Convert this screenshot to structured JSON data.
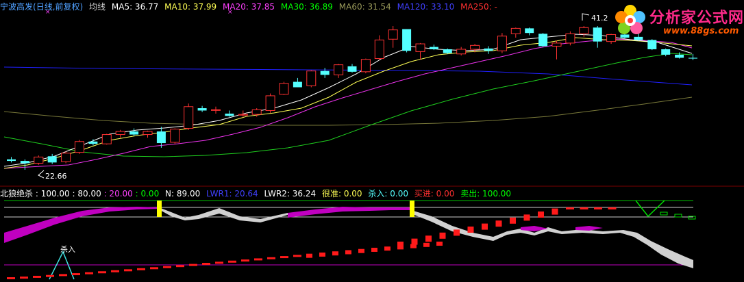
{
  "main_legend": {
    "stock": "宁波高发",
    "mode": "(日线,前复权)",
    "indicator": "均线",
    "ma5": "MA5: 36.77",
    "ma10": "MA10: 37.99",
    "ma20": "MA20: 37.85",
    "ma30": "MA30: 36.89",
    "ma60": "MA60: 31.54",
    "ma120": "MA120: 33.10",
    "ma250": "MA250: -"
  },
  "ind_legend": {
    "name": "北狼绝杀",
    "v1": ": 100.00",
    "v2": ": 80.00",
    "v3": ": 20.00",
    "v4": ": 0.00",
    "n": "N: 89.00",
    "lwr1": "LWR1: 20.64",
    "lwr2": "LWR2: 36.24",
    "hen": "很准: 0.00",
    "sharu": "杀入: 0.00",
    "maijin": "买进: 0.00",
    "maichu": "卖出: 100.00"
  },
  "annotations": {
    "high": "41.2",
    "low": "22.66",
    "kill_label": "杀入"
  },
  "logo": {
    "text": "分析家公式网",
    "url": "www.88gs.com"
  },
  "colors": {
    "up": "#ff3232",
    "down": "#54ffff",
    "ma5": "#ffffff",
    "ma10": "#ffff55",
    "ma20": "#ff40ff",
    "ma30": "#00ff00",
    "ma60": "#808040",
    "ma120": "#0000ff",
    "ma250": "#ff0000"
  },
  "chart_data": {
    "type": "candlestick",
    "ohlc": [
      [
        24.0,
        24.3,
        23.6,
        23.8
      ],
      [
        23.8,
        24.0,
        22.66,
        23.5
      ],
      [
        23.5,
        24.5,
        23.3,
        24.3
      ],
      [
        24.4,
        24.7,
        23.4,
        23.6
      ],
      [
        23.7,
        25.0,
        23.5,
        24.8
      ],
      [
        24.9,
        26.5,
        24.7,
        26.3
      ],
      [
        26.3,
        26.6,
        25.8,
        26.0
      ],
      [
        26.0,
        27.3,
        25.9,
        27.2
      ],
      [
        27.2,
        27.8,
        26.8,
        27.6
      ],
      [
        27.6,
        28.0,
        27.0,
        27.2
      ],
      [
        27.2,
        27.7,
        26.8,
        27.6
      ],
      [
        27.6,
        28.2,
        25.5,
        26.1
      ],
      [
        26.2,
        28.0,
        26.0,
        27.9
      ],
      [
        28.0,
        31.2,
        27.8,
        30.8
      ],
      [
        30.6,
        30.9,
        30.1,
        30.3
      ],
      [
        30.4,
        30.8,
        29.9,
        30.4
      ],
      [
        29.9,
        30.3,
        29.5,
        29.6
      ],
      [
        29.7,
        30.3,
        29.5,
        29.8
      ],
      [
        29.8,
        30.6,
        29.5,
        30.4
      ],
      [
        30.3,
        32.5,
        30.0,
        32.2
      ],
      [
        32.4,
        34.0,
        32.3,
        33.8
      ],
      [
        34.0,
        34.5,
        33.3,
        33.3
      ],
      [
        33.5,
        35.5,
        33.3,
        35.4
      ],
      [
        35.4,
        35.8,
        34.5,
        34.9
      ],
      [
        34.9,
        36.3,
        34.5,
        36.2
      ],
      [
        36.0,
        36.3,
        35.2,
        35.3
      ],
      [
        35.3,
        37.0,
        35.1,
        36.9
      ],
      [
        37.0,
        40.0,
        36.8,
        39.4
      ],
      [
        39.5,
        41.2,
        38.4,
        40.7
      ],
      [
        40.8,
        40.8,
        37.8,
        38.0
      ],
      [
        37.9,
        39.0,
        36.9,
        38.9
      ],
      [
        38.5,
        38.8,
        38.1,
        38.2
      ],
      [
        38.2,
        38.3,
        37.6,
        37.7
      ],
      [
        37.6,
        38.5,
        37.4,
        38.2
      ],
      [
        38.2,
        38.9,
        37.8,
        38.7
      ],
      [
        38.3,
        38.6,
        37.6,
        38.0
      ],
      [
        38.0,
        40.3,
        37.7,
        39.9
      ],
      [
        40.2,
        41.0,
        39.7,
        40.9
      ],
      [
        40.9,
        41.0,
        40.0,
        40.3
      ],
      [
        40.2,
        40.3,
        38.5,
        38.6
      ],
      [
        38.6,
        39.3,
        36.9,
        39.0
      ],
      [
        39.0,
        40.5,
        38.7,
        40.2
      ],
      [
        40.2,
        41.2,
        39.8,
        41.0
      ],
      [
        41.0,
        41.2,
        38.4,
        39.2
      ],
      [
        39.2,
        40.2,
        38.9,
        40.1
      ],
      [
        40.1,
        40.3,
        39.6,
        39.7
      ],
      [
        39.8,
        40.2,
        39.3,
        39.4
      ],
      [
        39.4,
        39.5,
        38.1,
        38.2
      ],
      [
        38.2,
        38.3,
        37.3,
        37.5
      ],
      [
        37.5,
        37.8,
        37.0,
        37.1
      ],
      [
        37.1,
        37.6,
        36.8,
        37.0
      ]
    ]
  }
}
